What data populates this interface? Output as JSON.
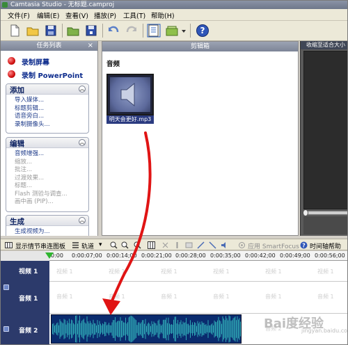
{
  "window": {
    "title": "Camtasia Studio - 无标题.camproj"
  },
  "menu": [
    "文件(F)",
    "编辑(E)",
    "查看(V)",
    "播放(P)",
    "工具(T)",
    "帮助(H)"
  ],
  "taskpane": {
    "title": "任务列表",
    "close": "×",
    "record_screen": "录制屏幕",
    "record_ppt": "录制 PowerPoint",
    "groups": [
      {
        "title": "添加",
        "items": [
          "导入媒体...",
          "标题剪辑...",
          "语音旁白...",
          "录制摄像头..."
        ],
        "dim": [
          false,
          false,
          false,
          false
        ]
      },
      {
        "title": "编辑",
        "items": [
          "音频增强...",
          "缩放...",
          "批注...",
          "过渡效果...",
          "标题...",
          "Flash 测验与调查...",
          "画中画 (PIP)..."
        ],
        "dim": [
          false,
          true,
          true,
          true,
          true,
          true,
          true
        ]
      },
      {
        "title": "生成",
        "items": [
          "生成视频为..."
        ],
        "dim": [
          false
        ]
      }
    ]
  },
  "clipbin": {
    "title": "剪辑箱",
    "section": "音频",
    "clip_name": "明天会更好.mp3"
  },
  "preview": {
    "zoom_label": "收缩至适合大小"
  },
  "timeline_toolbar": {
    "storyboard": "显示情节串连图板",
    "tracks": "轨道",
    "apply_smartfocus": "应用 SmartFocus",
    "axis_help": "时间轴帮助"
  },
  "ruler": [
    "0:00",
    "0:00:07;00",
    "0:00:14;00",
    "0:00:21;00",
    "0:00:28;00",
    "0:00:35;00",
    "0:00:42;00",
    "0:00:49;00",
    "0:00:56;00"
  ],
  "tracks": {
    "video1": "视频 1",
    "audio1": "音频 1",
    "audio2": "音频 2",
    "ghost_video": "视频 1",
    "ghost_audio1": "音频 1",
    "ghost_audio2": "音频 2"
  },
  "watermark": {
    "main": "Bai度经验",
    "sub": "jingyan.baidu.com"
  },
  "colors": {
    "arrow": "#e01414",
    "waveform": "#2fa8b5",
    "track_label_bg": "#2c3a6b"
  }
}
